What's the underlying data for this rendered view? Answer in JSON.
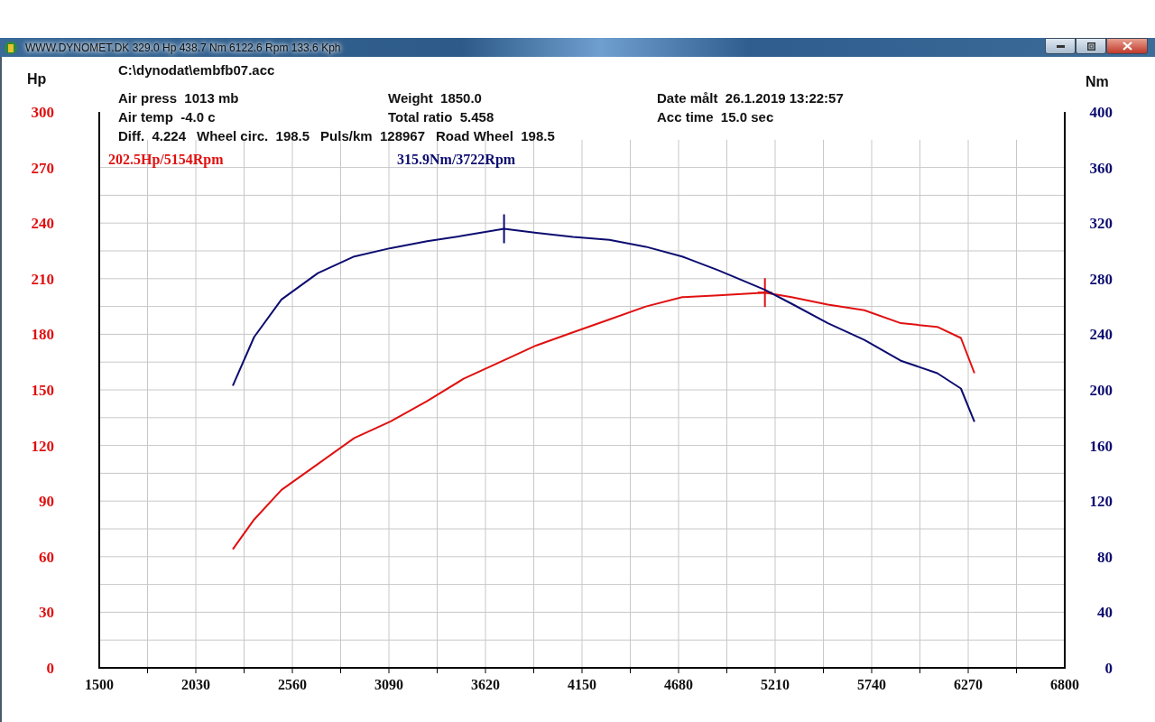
{
  "window": {
    "title": "WWW.DYNOMET.DK  329.0 Hp 438.7 Nm 6122.6 Rpm 133.6 Kph",
    "buttons": [
      {
        "kind": "minimize"
      },
      {
        "kind": "maximize"
      },
      {
        "kind": "close"
      }
    ]
  },
  "file_path": "C:\\dynodat\\embfb07.acc",
  "info_columns": [
    [
      {
        "label": "Air press",
        "value": "1013 mb"
      },
      {
        "label": "Air temp",
        "value": "-4.0 c"
      }
    ],
    [
      {
        "label": "Weight",
        "value": "1850.0"
      },
      {
        "label": "Total ratio",
        "value": "5.458"
      }
    ],
    [
      {
        "label": "Date målt",
        "value": "26.1.2019 13:22:57"
      },
      {
        "label": "Acc time",
        "value": "15.0 sec"
      }
    ]
  ],
  "info_line": [
    {
      "label": "Diff.",
      "value": "4.224"
    },
    {
      "label": "Wheel circ.",
      "value": "198.5"
    },
    {
      "label": "Puls/km",
      "value": "128967"
    },
    {
      "label": "Road Wheel",
      "value": "198.5"
    }
  ],
  "chart": {
    "chart_data": {
      "type": "line",
      "ylabel": "Hp",
      "y2label": "Nm",
      "grid": true,
      "x": [
        2233,
        2350,
        2500,
        2700,
        2900,
        3100,
        3300,
        3500,
        3722,
        3900,
        4100,
        4300,
        4500,
        4700,
        4900,
        5154,
        5300,
        5500,
        5700,
        5900,
        6100,
        6230,
        6304
      ],
      "series": [
        {
          "color": "#e01010",
          "values": [
            64,
            80,
            96,
            110,
            124,
            133,
            144,
            156,
            166,
            174,
            181,
            188,
            195,
            200,
            201,
            202.5,
            200,
            196,
            193,
            186,
            184,
            178,
            159
          ]
        },
        {
          "color": "#0c0c70",
          "axis": "y2",
          "values": [
            203,
            238,
            265,
            284,
            296,
            302,
            307,
            311,
            315.9,
            313,
            310,
            308,
            303,
            296,
            286,
            272,
            262,
            248,
            236,
            221,
            212,
            201,
            177
          ]
        }
      ],
      "xlim": [
        1500,
        6800
      ],
      "ylim": [
        0,
        300
      ],
      "y2lim": [
        0,
        400
      ],
      "xticks": [
        1500,
        2030,
        2560,
        3090,
        3620,
        4150,
        4680,
        5210,
        5740,
        6270,
        6800
      ],
      "yticks": [
        0,
        30,
        60,
        90,
        120,
        150,
        180,
        210,
        240,
        270,
        300
      ],
      "y2ticks": [
        0,
        40,
        80,
        120,
        160,
        200,
        240,
        280,
        320,
        360,
        400
      ],
      "annotations": [
        "202.5Hp/5154Rpm",
        "315.9Nm/3722Rpm"
      ]
    }
  }
}
